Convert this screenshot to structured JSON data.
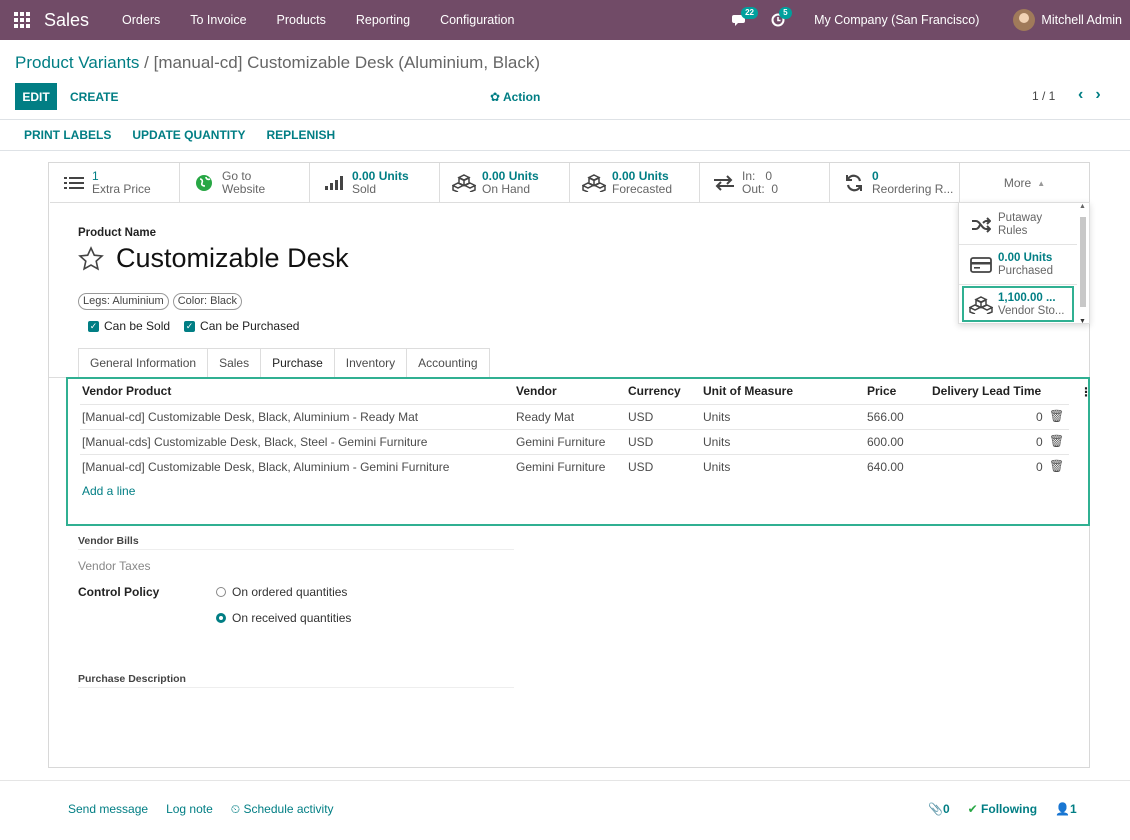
{
  "navbar": {
    "app": "Sales",
    "menus": [
      "Orders",
      "To Invoice",
      "Products",
      "Reporting",
      "Configuration"
    ],
    "messages_count": "22",
    "activities_count": "5",
    "company": "My Company (San Francisco)",
    "user": "Mitchell Admin"
  },
  "breadcrumb": {
    "parent": "Product Variants",
    "separator": " / ",
    "current": "[manual-cd] Customizable Desk (Aluminium, Black)"
  },
  "control": {
    "edit": "EDIT",
    "create": "CREATE",
    "action": "Action",
    "pager": "1 / 1"
  },
  "header_buttons": [
    "PRINT LABELS",
    "UPDATE QUANTITY",
    "REPLENISH"
  ],
  "smart_buttons": [
    {
      "icon": "list-icon",
      "value": "1",
      "label": "Extra Price"
    },
    {
      "icon": "globe-icon",
      "value": "Go to",
      "label": "Website"
    },
    {
      "icon": "signal-icon",
      "value": "0.00 Units",
      "label": "Sold"
    },
    {
      "icon": "cubes-icon",
      "value": "0.00 Units",
      "label": "On Hand"
    },
    {
      "icon": "cubes-icon",
      "value": "0.00 Units",
      "label": "Forecasted"
    },
    {
      "icon": "exchange-icon",
      "value": "In:   0",
      "label": "Out:  0"
    },
    {
      "icon": "refresh-icon",
      "value": "0",
      "label": "Reordering R..."
    }
  ],
  "more_label": "More",
  "more_dropdown": [
    {
      "icon": "random-icon",
      "value": "Putaway",
      "label": "Rules"
    },
    {
      "icon": "credit-card-icon",
      "value": "0.00 Units",
      "label": "Purchased"
    },
    {
      "icon": "cubes-icon",
      "value": "1,100.00 ...",
      "label": "Vendor Sto..."
    }
  ],
  "product": {
    "name_label": "Product Name",
    "name": "Customizable Desk",
    "tags": [
      "Legs: Aluminium",
      "Color: Black"
    ],
    "can_be_sold": "Can be Sold",
    "can_be_purchased": "Can be Purchased"
  },
  "tabs": [
    "General Information",
    "Sales",
    "Purchase",
    "Inventory",
    "Accounting"
  ],
  "active_tab": "Purchase",
  "vendor_table": {
    "headers": [
      "Vendor Product",
      "Vendor",
      "Currency",
      "Unit of Measure",
      "Price",
      "Delivery Lead Time"
    ],
    "rows": [
      [
        "[Manual-cd] Customizable Desk, Black, Aluminium - Ready Mat",
        "Ready Mat",
        "USD",
        "Units",
        "566.00",
        "0"
      ],
      [
        "[Manual-cds] Customizable Desk, Black, Steel - Gemini Furniture",
        "Gemini Furniture",
        "USD",
        "Units",
        "600.00",
        "0"
      ],
      [
        "[Manual-cd] Customizable Desk, Black, Aluminium - Gemini Furniture",
        "Gemini Furniture",
        "USD",
        "Units",
        "640.00",
        "0"
      ]
    ],
    "add_line": "Add a line"
  },
  "vendor_bills": {
    "section": "Vendor Bills",
    "taxes_label": "Vendor Taxes",
    "control_policy_label": "Control Policy",
    "option_ordered": "On ordered quantities",
    "option_received": "On received quantities",
    "selected": "On received quantities"
  },
  "purchase_description_label": "Purchase Description",
  "chatter": {
    "send_message": "Send message",
    "log_note": "Log note",
    "schedule_activity": "Schedule activity",
    "attachments": "0",
    "following": "Following",
    "followers": "1"
  },
  "colors": {
    "navbar": "#714b67",
    "primary": "#017e84",
    "highlight": "#30b092"
  }
}
